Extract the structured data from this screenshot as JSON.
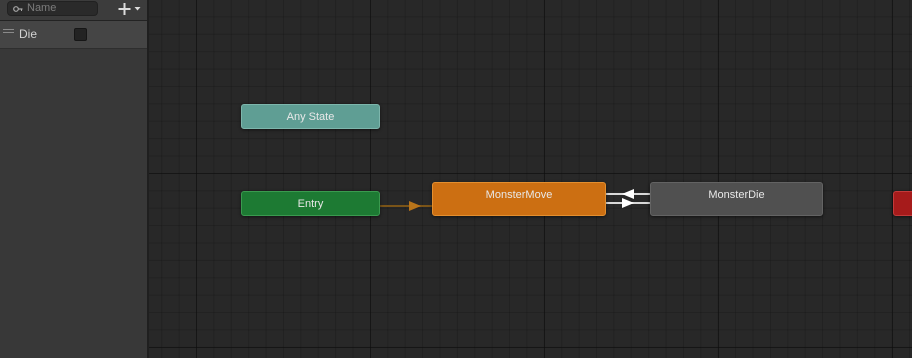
{
  "parameters_panel": {
    "search": {
      "placeholder": "Name"
    },
    "add_button": {
      "icon": "plus-icon",
      "dropdown_icon": "chevron-down-icon"
    },
    "parameters": [
      {
        "name": "Die",
        "type": "bool",
        "value": false
      }
    ]
  },
  "graph": {
    "states": {
      "any_state": {
        "label": "Any State",
        "color": "#5f9e94"
      },
      "entry": {
        "label": "Entry",
        "color": "#1d7a33"
      },
      "monster_move": {
        "label": "MonsterMove",
        "color": "#cc6f12"
      },
      "monster_die": {
        "label": "MonsterDie",
        "color": "#505050"
      },
      "exit": {
        "label": "",
        "color": "#a61b1b"
      }
    },
    "transitions": [
      {
        "from": "Entry",
        "to": "MonsterMove",
        "color": "#b8741a"
      },
      {
        "from": "MonsterMove",
        "to": "MonsterDie",
        "color": "#ffffff"
      },
      {
        "from": "MonsterDie",
        "to": "MonsterMove",
        "color": "#ffffff"
      }
    ]
  }
}
